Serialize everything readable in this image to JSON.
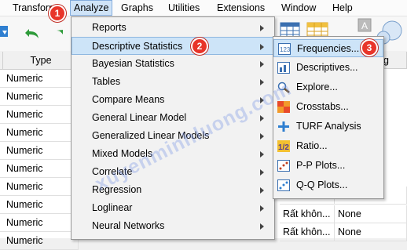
{
  "menubar": {
    "items": [
      {
        "label": "Transform"
      },
      {
        "label": "Analyze"
      },
      {
        "label": "Graphs"
      },
      {
        "label": "Utilities"
      },
      {
        "label": "Extensions"
      },
      {
        "label": "Window"
      },
      {
        "label": "Help"
      }
    ]
  },
  "grid": {
    "header_type": "Type",
    "header_partial": "g",
    "type_values": [
      "Numeric",
      "Numeric",
      "Numeric",
      "Numeric",
      "Numeric",
      "Numeric",
      "Numeric",
      "Numeric",
      "Numeric",
      "Numeric"
    ],
    "lower_rows": [
      {
        "label": "Rất khôn...",
        "missing": "None"
      },
      {
        "label": "Rất khôn...",
        "missing": "None"
      },
      {
        "label": "Rất khôn...",
        "missing": "None"
      }
    ]
  },
  "analyze_menu": {
    "items": [
      {
        "label": "Reports"
      },
      {
        "label": "Descriptive Statistics"
      },
      {
        "label": "Bayesian Statistics"
      },
      {
        "label": "Tables"
      },
      {
        "label": "Compare Means"
      },
      {
        "label": "General Linear Model"
      },
      {
        "label": "Generalized Linear Models"
      },
      {
        "label": "Mixed Models"
      },
      {
        "label": "Correlate"
      },
      {
        "label": "Regression"
      },
      {
        "label": "Loglinear"
      },
      {
        "label": "Neural Networks"
      }
    ]
  },
  "descriptive_submenu": {
    "items": [
      {
        "label": "Frequencies...",
        "icon": "frequencies-icon"
      },
      {
        "label": "Descriptives...",
        "icon": "descriptives-icon"
      },
      {
        "label": "Explore...",
        "icon": "explore-icon"
      },
      {
        "label": "Crosstabs...",
        "icon": "crosstabs-icon"
      },
      {
        "label": "TURF Analysis",
        "icon": "turf-icon"
      },
      {
        "label": "Ratio...",
        "icon": "ratio-icon"
      },
      {
        "label": "P-P Plots...",
        "icon": "pp-plot-icon"
      },
      {
        "label": "Q-Q Plots...",
        "icon": "qq-plot-icon"
      }
    ]
  },
  "step_badges": [
    "1",
    "2",
    "3"
  ],
  "watermark": "xuyenminhluong.com",
  "colors": {
    "highlight": "#cde4f8",
    "badge": "#e8352a"
  }
}
